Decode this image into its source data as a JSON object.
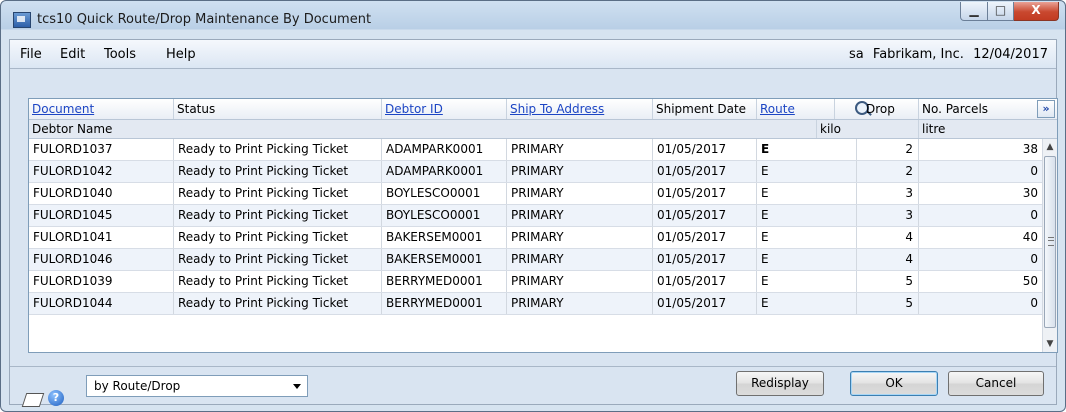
{
  "window": {
    "title": "tcs10 Quick Route/Drop Maintenance By Document",
    "controls": {
      "minimize": "▁",
      "maximize": "□",
      "close": "X"
    }
  },
  "menu": [
    "File",
    "Edit",
    "Tools",
    "Help"
  ],
  "user_info": {
    "user": "sa",
    "company": "Fabrikam, Inc.",
    "date": "12/04/2017"
  },
  "grid": {
    "headers": {
      "document": "Document",
      "status": "Status",
      "debtor_id": "Debtor ID",
      "ship_to": "Ship To Address",
      "shipment_date": "Shipment Date",
      "route": "Route",
      "drop": "Drop",
      "parcels": "No. Parcels"
    },
    "expand_glyph": "»",
    "subheaders": {
      "debtor_name": "Debtor Name",
      "kilo": "kilo",
      "litre": "litre"
    },
    "rows": [
      {
        "document": "FULORD1037",
        "status": "Ready to Print Picking Ticket",
        "debtor_id": "ADAMPARK0001",
        "ship_to": "PRIMARY",
        "date": "01/05/2017",
        "route": "E",
        "drop": "2",
        "parcels": "38"
      },
      {
        "document": "FULORD1042",
        "status": "Ready to Print Picking Ticket",
        "debtor_id": "ADAMPARK0001",
        "ship_to": "PRIMARY",
        "date": "01/05/2017",
        "route": "E",
        "drop": "2",
        "parcels": "0"
      },
      {
        "document": "FULORD1040",
        "status": "Ready to Print Picking Ticket",
        "debtor_id": "BOYLESCO0001",
        "ship_to": "PRIMARY",
        "date": "01/05/2017",
        "route": "E",
        "drop": "3",
        "parcels": "30"
      },
      {
        "document": "FULORD1045",
        "status": "Ready to Print Picking Ticket",
        "debtor_id": "BOYLESCO0001",
        "ship_to": "PRIMARY",
        "date": "01/05/2017",
        "route": "E",
        "drop": "3",
        "parcels": "0"
      },
      {
        "document": "FULORD1041",
        "status": "Ready to Print Picking Ticket",
        "debtor_id": "BAKERSEM0001",
        "ship_to": "PRIMARY",
        "date": "01/05/2017",
        "route": "E",
        "drop": "4",
        "parcels": "40"
      },
      {
        "document": "FULORD1046",
        "status": "Ready to Print Picking Ticket",
        "debtor_id": "BAKERSEM0001",
        "ship_to": "PRIMARY",
        "date": "01/05/2017",
        "route": "E",
        "drop": "4",
        "parcels": "0"
      },
      {
        "document": "FULORD1039",
        "status": "Ready to Print Picking Ticket",
        "debtor_id": "BERRYMED0001",
        "ship_to": "PRIMARY",
        "date": "01/05/2017",
        "route": "E",
        "drop": "5",
        "parcels": "50"
      },
      {
        "document": "FULORD1044",
        "status": "Ready to Print Picking Ticket",
        "debtor_id": "BERRYMED0001",
        "ship_to": "PRIMARY",
        "date": "01/05/2017",
        "route": "E",
        "drop": "5",
        "parcels": "0"
      }
    ],
    "scroll": {
      "up": "▲",
      "down": "▼"
    }
  },
  "footer": {
    "help_glyph": "?",
    "sort_by": "by Route/Drop",
    "buttons": {
      "redisplay": "Redisplay",
      "ok": "OK",
      "cancel": "Cancel"
    }
  }
}
